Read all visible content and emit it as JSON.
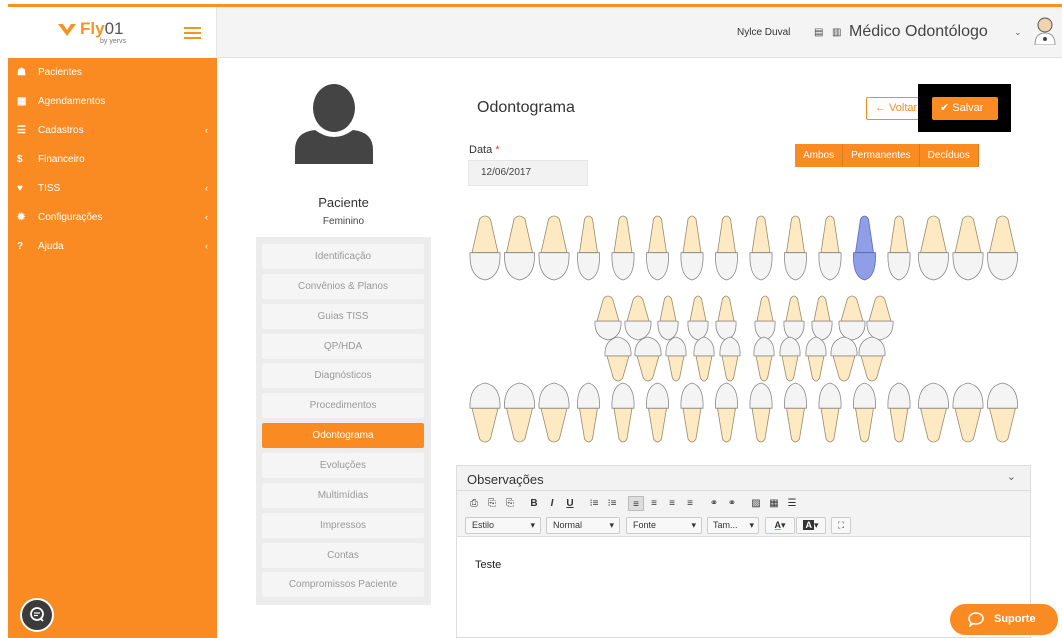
{
  "app": {
    "brand": "Fly",
    "brand_suffix": "01",
    "by_text": "by yervs"
  },
  "sidebar": {
    "items": [
      {
        "label": "Pacientes",
        "icon": "users-icon",
        "glyph": "☗",
        "chevron": false
      },
      {
        "label": "Agendamentos",
        "icon": "calendar-icon",
        "glyph": "▦",
        "chevron": false
      },
      {
        "label": "Cadastros",
        "icon": "list-icon",
        "glyph": "☰",
        "chevron": true
      },
      {
        "label": "Financeiro",
        "icon": "dollar-icon",
        "glyph": "$",
        "chevron": false
      },
      {
        "label": "TISS",
        "icon": "handshake-icon",
        "glyph": "♥",
        "chevron": true
      },
      {
        "label": "Configurações",
        "icon": "gear-icon",
        "glyph": "✹",
        "chevron": true
      },
      {
        "label": "Ajuda",
        "icon": "question-icon",
        "glyph": "?",
        "chevron": true
      }
    ],
    "chevron_glyph": "‹"
  },
  "topbar": {
    "user_name": "Nylce Duval",
    "flag_icon_1": "▤",
    "flag_icon_2": "▥",
    "role": "Médico Odontólogo",
    "role_chevron": "⌄"
  },
  "patient": {
    "name": "Paciente",
    "sex": "Feminino"
  },
  "side_nav": {
    "items": [
      "Identificação",
      "Convênios & Planos",
      "Guias TISS",
      "QP/HDA",
      "Diagnósticos",
      "Procedimentos",
      "Odontograma",
      "Evoluções",
      "Multimídias",
      "Impressos",
      "Contas",
      "Compromissos Paciente"
    ],
    "active_index": 6
  },
  "page": {
    "title": "Odontograma"
  },
  "actions": {
    "back_label": "← Voltar",
    "save_label": "✔ Salvar"
  },
  "form": {
    "data_label": "Data",
    "required_mark": "*",
    "data_value": "12/06/2017"
  },
  "segment": {
    "options": [
      "Ambos",
      "Permanentes",
      "Decíduos"
    ],
    "selected": "Ambos"
  },
  "observacoes": {
    "title": "Observações",
    "collapse_glyph": "⌄",
    "text": "Teste",
    "toolbar_row1": [
      "⎙",
      "⎘",
      "⎘",
      "B",
      "I",
      "U",
      "⁝≡",
      "⁝≡",
      "≡",
      "≡",
      "≡",
      "≡",
      "⚭",
      "⚭",
      "▨",
      "▦",
      "☰"
    ],
    "toolbar_row2": {
      "estilo": "Estilo",
      "normal": "Normal",
      "fonte": "Fonte",
      "tamanho": "Tam...",
      "font_color": "A",
      "bg_color": "A",
      "maximize": "⛶"
    }
  },
  "support": {
    "label": "Suporte"
  },
  "colors": {
    "accent": "#f98b22",
    "tooth_fill": "#fde9c2",
    "selected_tooth": "#8f9ee6",
    "chat_button": "#3b3b3b"
  },
  "odontogram": {
    "selected_tooth": "upper permanent right lateral incisor"
  }
}
